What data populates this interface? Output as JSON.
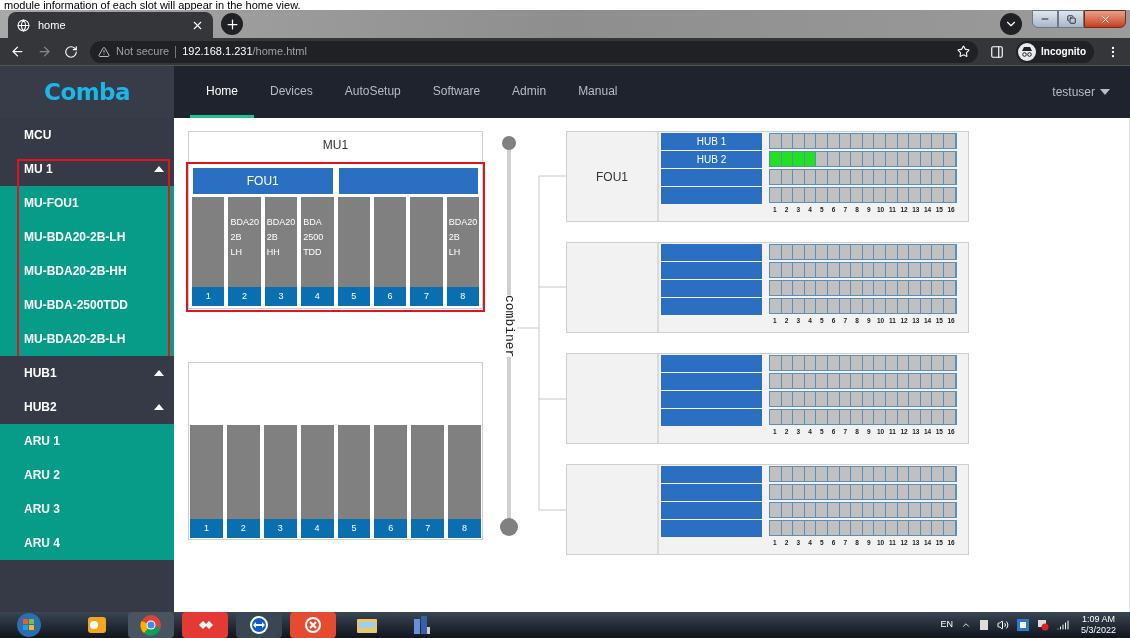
{
  "caption": "module information of each slot will appear in the home view.",
  "browser": {
    "tab_title": "home",
    "security": "Not secure",
    "host": "192.168.1.231",
    "path": "/home.html",
    "profile": "Incognito"
  },
  "app": {
    "logo": "Comba",
    "nav": [
      {
        "label": "Home",
        "selected": true
      },
      {
        "label": "Devices",
        "selected": false
      },
      {
        "label": "AutoSetup",
        "selected": false
      },
      {
        "label": "Software",
        "selected": false
      },
      {
        "label": "Admin",
        "selected": false
      },
      {
        "label": "Manual",
        "selected": false
      }
    ],
    "user": "testuser"
  },
  "sidebar": [
    {
      "label": "MCU",
      "highlighted": false
    },
    {
      "label": "MU 1",
      "expanded": true,
      "highlighted": true,
      "children": [
        {
          "label": "MU-FOU1"
        },
        {
          "label": "MU-BDA20-2B-LH"
        },
        {
          "label": "MU-BDA20-2B-HH"
        },
        {
          "label": "MU-BDA-2500TDD"
        },
        {
          "label": "MU-BDA20-2B-LH"
        }
      ]
    },
    {
      "label": "HUB1",
      "expanded": true,
      "highlighted": false
    },
    {
      "label": "HUB2",
      "expanded": true,
      "highlighted": false,
      "children": [
        {
          "label": "ARU 1"
        },
        {
          "label": "ARU 2"
        },
        {
          "label": "ARU 3"
        },
        {
          "label": "ARU 4"
        }
      ]
    }
  ],
  "mu_panels": [
    {
      "title": "MU1",
      "highlighted": true,
      "bars": [
        {
          "kind": "labeled",
          "label": "FOU1"
        },
        {
          "kind": "empty"
        }
      ],
      "slots": [
        {
          "number": "1"
        },
        {
          "number": "2",
          "lines": [
            "BDA20",
            "2B",
            "LH"
          ]
        },
        {
          "number": "3",
          "lines": [
            "BDA20",
            "2B",
            "HH"
          ]
        },
        {
          "number": "4",
          "lines": [
            "BDA",
            "2500",
            "TDD"
          ]
        },
        {
          "number": "5"
        },
        {
          "number": "6"
        },
        {
          "number": "7"
        },
        {
          "number": "8",
          "lines": [
            "BDA20",
            "2B",
            "LH"
          ]
        }
      ]
    },
    {
      "highlighted": false,
      "slots": [
        {
          "number": "1"
        },
        {
          "number": "2"
        },
        {
          "number": "3"
        },
        {
          "number": "4"
        },
        {
          "number": "5"
        },
        {
          "number": "6"
        },
        {
          "number": "7"
        },
        {
          "number": "8"
        }
      ]
    }
  ],
  "combiner": "combiner",
  "hub_panels": [
    {
      "label": "FOU1",
      "column_numbers": [
        "1",
        "2",
        "3",
        "4",
        "5",
        "6",
        "7",
        "8",
        "9",
        "10",
        "11",
        "12",
        "13",
        "14",
        "15",
        "16"
      ],
      "ports": [
        {
          "label": "HUB 1",
          "cells": [
            false,
            false,
            false,
            false,
            false,
            false,
            false,
            false,
            false,
            false,
            false,
            false,
            false,
            false,
            false,
            false
          ]
        },
        {
          "label": "HUB 2",
          "cells": [
            true,
            true,
            true,
            true,
            false,
            false,
            false,
            false,
            false,
            false,
            false,
            false,
            false,
            false,
            false,
            false
          ]
        },
        {
          "cells": [
            false,
            false,
            false,
            false,
            false,
            false,
            false,
            false,
            false,
            false,
            false,
            false,
            false,
            false,
            false,
            false
          ]
        },
        {
          "cells": [
            false,
            false,
            false,
            false,
            false,
            false,
            false,
            false,
            false,
            false,
            false,
            false,
            false,
            false,
            false,
            false
          ]
        }
      ]
    },
    {
      "column_numbers": [
        "1",
        "2",
        "3",
        "4",
        "5",
        "6",
        "7",
        "8",
        "9",
        "10",
        "11",
        "12",
        "13",
        "14",
        "15",
        "16"
      ],
      "ports": [
        {
          "cells": [
            false,
            false,
            false,
            false,
            false,
            false,
            false,
            false,
            false,
            false,
            false,
            false,
            false,
            false,
            false,
            false
          ]
        },
        {
          "cells": [
            false,
            false,
            false,
            false,
            false,
            false,
            false,
            false,
            false,
            false,
            false,
            false,
            false,
            false,
            false,
            false
          ]
        },
        {
          "cells": [
            false,
            false,
            false,
            false,
            false,
            false,
            false,
            false,
            false,
            false,
            false,
            false,
            false,
            false,
            false,
            false
          ]
        },
        {
          "cells": [
            false,
            false,
            false,
            false,
            false,
            false,
            false,
            false,
            false,
            false,
            false,
            false,
            false,
            false,
            false,
            false
          ]
        }
      ]
    },
    {
      "column_numbers": [
        "1",
        "2",
        "3",
        "4",
        "5",
        "6",
        "7",
        "8",
        "9",
        "10",
        "11",
        "12",
        "13",
        "14",
        "15",
        "16"
      ],
      "ports": [
        {
          "cells": [
            false,
            false,
            false,
            false,
            false,
            false,
            false,
            false,
            false,
            false,
            false,
            false,
            false,
            false,
            false,
            false
          ]
        },
        {
          "cells": [
            false,
            false,
            false,
            false,
            false,
            false,
            false,
            false,
            false,
            false,
            false,
            false,
            false,
            false,
            false,
            false
          ]
        },
        {
          "cells": [
            false,
            false,
            false,
            false,
            false,
            false,
            false,
            false,
            false,
            false,
            false,
            false,
            false,
            false,
            false,
            false
          ]
        },
        {
          "cells": [
            false,
            false,
            false,
            false,
            false,
            false,
            false,
            false,
            false,
            false,
            false,
            false,
            false,
            false,
            false,
            false
          ]
        }
      ]
    },
    {
      "column_numbers": [
        "1",
        "2",
        "3",
        "4",
        "5",
        "6",
        "7",
        "8",
        "9",
        "10",
        "11",
        "12",
        "13",
        "14",
        "15",
        "16"
      ],
      "ports": [
        {
          "cells": [
            false,
            false,
            false,
            false,
            false,
            false,
            false,
            false,
            false,
            false,
            false,
            false,
            false,
            false,
            false,
            false
          ]
        },
        {
          "cells": [
            false,
            false,
            false,
            false,
            false,
            false,
            false,
            false,
            false,
            false,
            false,
            false,
            false,
            false,
            false,
            false
          ]
        },
        {
          "cells": [
            false,
            false,
            false,
            false,
            false,
            false,
            false,
            false,
            false,
            false,
            false,
            false,
            false,
            false,
            false,
            false
          ]
        },
        {
          "cells": [
            false,
            false,
            false,
            false,
            false,
            false,
            false,
            false,
            false,
            false,
            false,
            false,
            false,
            false,
            false,
            false
          ]
        }
      ]
    }
  ],
  "taskbar": {
    "language": "EN",
    "time": "1:09 AM",
    "date": "5/3/2022"
  }
}
